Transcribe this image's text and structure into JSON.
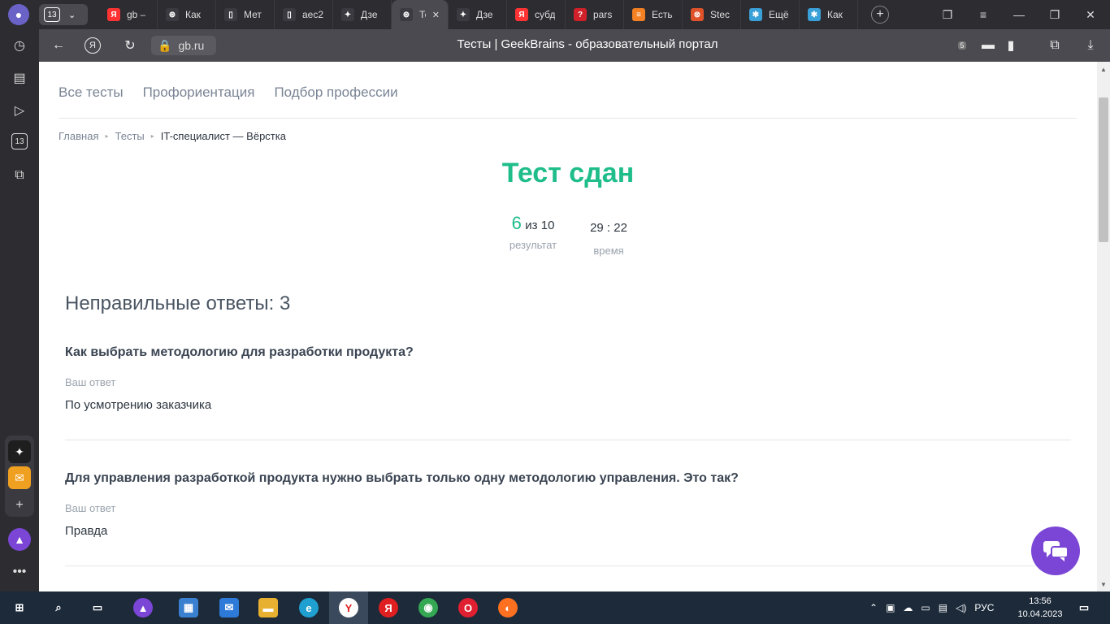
{
  "browser": {
    "tab_count": "13",
    "tabs": [
      {
        "icon": "yandex-icon",
        "color": "#ff3333",
        "label": "gb –"
      },
      {
        "icon": "openai-icon",
        "color": "#3a3a40",
        "label": "Как"
      },
      {
        "icon": "document-icon",
        "color": "#3a3a40",
        "label": "Мет"
      },
      {
        "icon": "document-icon",
        "color": "#3a3a40",
        "label": "aec2"
      },
      {
        "icon": "zen-icon",
        "color": "#3a3a40",
        "label": "Дзе"
      },
      {
        "icon": "openai-icon",
        "color": "#3a3a40",
        "label": "Те"
      },
      {
        "icon": "zen-icon",
        "color": "#3a3a40",
        "label": "Дзе"
      },
      {
        "icon": "yandex-icon",
        "color": "#ff3333",
        "label": "субд"
      },
      {
        "icon": "question-icon",
        "color": "#d0202a",
        "label": "pars"
      },
      {
        "icon": "stackoverflow-icon",
        "color": "#f48024",
        "label": "Есть"
      },
      {
        "icon": "stepik-icon",
        "color": "#e0522a",
        "label": "Stec"
      },
      {
        "icon": "gear-app-icon",
        "color": "#3aa0d8",
        "label": "Ещё"
      },
      {
        "icon": "gear-app-icon",
        "color": "#3aa0d8",
        "label": "Как"
      }
    ],
    "active_tab_index": 5,
    "url": "gb.ru",
    "page_title": "Тесты | GeekBrains - образовательный портал",
    "notification_count": "5"
  },
  "page": {
    "topnav": [
      "Все тесты",
      "Профориентация",
      "Подбор профессии"
    ],
    "breadcrumb": {
      "home": "Главная",
      "tests": "Тесты",
      "current": "IT-специалист — Вёрстка"
    },
    "result_title": "Тест сдан",
    "score": {
      "value": "6",
      "of": "из 10",
      "caption": "результат"
    },
    "time": {
      "value": "29 : 22",
      "caption": "время"
    },
    "wrong_title": "Неправильные ответы: 3",
    "questions": [
      {
        "question": "Как выбрать методологию для разработки продукта?",
        "label": "Ваш ответ",
        "answer": "По усмотрению заказчика"
      },
      {
        "question": "Для управления разработкой продукта нужно выбрать только одну методологию управления. Это так?",
        "label": "Ваш ответ",
        "answer": "Правда"
      }
    ]
  },
  "taskbar": {
    "language": "РУС",
    "time": "13:56",
    "date": "10.04.2023"
  },
  "sidebar_badge": "13",
  "colors": {
    "accent": "#1fbd8a",
    "chat": "#7b46d6"
  }
}
